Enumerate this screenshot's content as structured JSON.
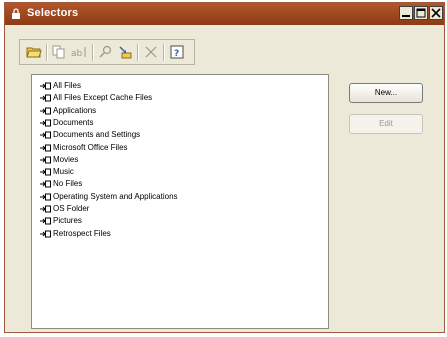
{
  "window": {
    "title": "Selectors",
    "accent": "#9c4720"
  },
  "toolbar": {
    "buttons": [
      {
        "name": "open-folder-icon"
      },
      {
        "name": "duplicate-icon"
      },
      {
        "name": "rename-icon"
      },
      {
        "name": "find-icon"
      },
      {
        "name": "move-icon"
      },
      {
        "name": "delete-icon"
      },
      {
        "name": "help-icon"
      }
    ]
  },
  "list": {
    "items": [
      "All Files",
      "All Files Except Cache Files",
      "Applications",
      "Documents",
      "Documents and Settings",
      "Microsoft Office Files",
      "Movies",
      "Music",
      "No Files",
      "Operating System and Applications",
      "OS Folder",
      "Pictures",
      "Retrospect Files"
    ]
  },
  "actions": {
    "new_label": "New...",
    "edit_label": "Edit"
  }
}
